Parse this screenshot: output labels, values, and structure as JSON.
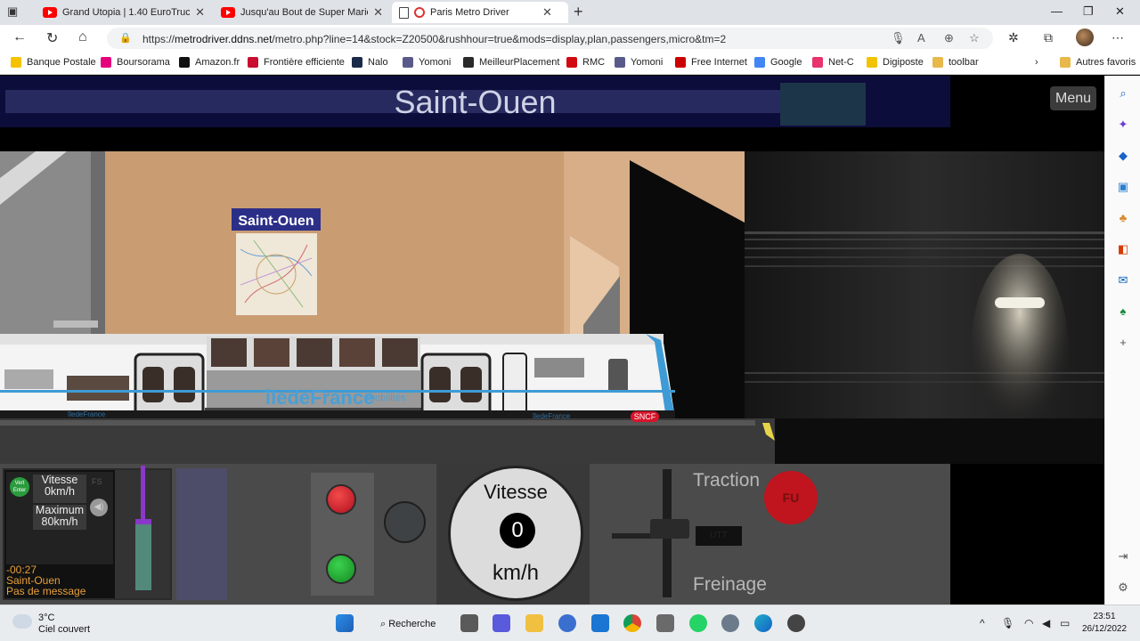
{
  "browser": {
    "tabs": [
      {
        "title": "Grand Utopia | 1.40 EuroTruck Sim",
        "icon": "youtube-icon",
        "active": false
      },
      {
        "title": "Jusqu'au Bout de Super Mario 3D",
        "icon": "youtube-icon",
        "active": false
      },
      {
        "title": "Paris Metro Driver",
        "icon": "record-icon",
        "active": true
      }
    ],
    "url": "https://metrodriver.ddns.net/metro.php?line=14&stock=Z20500&rushhour=true&mods=display,plan,passengers,micro&tm=2",
    "url_host": "metrodriver.ddns.net",
    "url_prefix": "https://",
    "url_path": "/metro.php?line=14&stock=Z20500&rushhour=true&mods=display,plan,passengers,micro&tm=2",
    "bookmarks": [
      {
        "label": "Banque Postale",
        "color": "#f6c200"
      },
      {
        "label": "Boursorama",
        "color": "#e4007c"
      },
      {
        "label": "Amazon.fr",
        "color": "#111111"
      },
      {
        "label": "Frontière efficiente",
        "color": "#c8102e"
      },
      {
        "label": "Nalo",
        "color": "#1b2a48"
      },
      {
        "label": "Yomoni",
        "color": "#5a5a8a"
      },
      {
        "label": "MeilleurPlacement",
        "color": "#2a2a2a"
      },
      {
        "label": "RMC",
        "color": "#d10a11"
      },
      {
        "label": "Yomoni",
        "color": "#5a5a8a"
      },
      {
        "label": "Free Internet",
        "color": "#cc0000"
      },
      {
        "label": "Google",
        "color": "#4285f4"
      },
      {
        "label": "Net-C",
        "color": "#e8336d"
      },
      {
        "label": "Digiposte",
        "color": "#f2c300"
      },
      {
        "label": "toolbar",
        "color": "#e8b84a"
      }
    ],
    "other_favorites": "Autres favoris"
  },
  "game": {
    "station_name": "Saint-Ouen",
    "sign_text": "Saint-Ouen",
    "menu_label": "Menu",
    "train_brand": "îledeFrance",
    "train_brand_suffix": "mobilités",
    "train_small_brand": "îledeFrance",
    "sncf": "SNCF"
  },
  "dashboard": {
    "status_tag": "Vert Enter",
    "fs_label": "FS",
    "vitesse_label": "Vitesse",
    "vitesse_value": "0km/h",
    "maximum_label": "Maximum",
    "maximum_value": "80km/h",
    "timer": "-00:27",
    "station": "Saint-Ouen",
    "message": "Pas de message",
    "speedo_title": "Vitesse",
    "speedo_value": "0",
    "speedo_unit": "km/h",
    "traction_label": "Traction",
    "freinage_label": "Freinage",
    "lever_display": "UTT",
    "fu_label": "FU",
    "red_lamp_color": "#d81b2a",
    "green_lamp_color": "#22a833"
  },
  "taskbar": {
    "temperature": "3°C",
    "weather": "Ciel couvert",
    "search_label": "Recherche",
    "time": "23:51",
    "date": "26/12/2022"
  }
}
